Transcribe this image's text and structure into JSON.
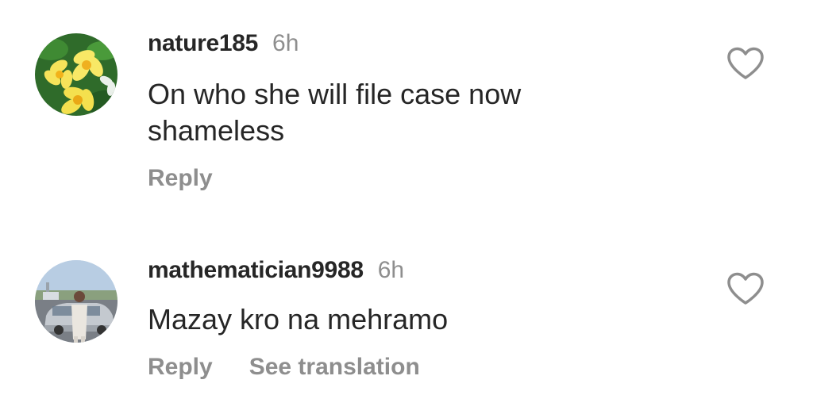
{
  "comments": [
    {
      "avatar_icon": "flower-avatar",
      "username": "nature185",
      "time": "6h",
      "text": "On who she will file case now shameless",
      "reply_label": "Reply",
      "like_icon": "heart-outline-icon"
    },
    {
      "avatar_icon": "person-car-avatar",
      "username": "mathematician9988",
      "time": "6h",
      "text": "Mazay kro na mehramo",
      "reply_label": "Reply",
      "translate_label": "See translation",
      "like_icon": "heart-outline-icon"
    }
  ],
  "colors": {
    "text": "#262626",
    "muted": "#8e8e8e",
    "background": "#ffffff"
  }
}
